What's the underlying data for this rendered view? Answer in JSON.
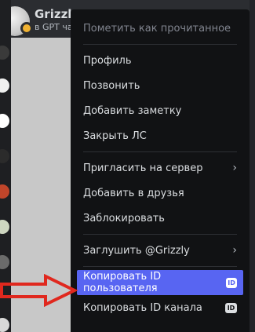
{
  "dm": {
    "name": "Grizzly",
    "subtitle": "в GPT ча"
  },
  "menu": {
    "mark_read": "Пометить как прочитанное",
    "profile": "Профиль",
    "call": "Позвонить",
    "add_note": "Добавить заметку",
    "close_dm": "Закрыть ЛС",
    "invite": "Пригласить на сервер",
    "add_friend": "Добавить в друзья",
    "block": "Заблокировать",
    "mute": "Заглушить @Grizzly",
    "copy_user_id": "Копировать ID пользователя",
    "copy_channel_id": "Копировать ID канала"
  },
  "badges": {
    "id": "ID"
  },
  "icons": {
    "submenu": "chevron-right-icon",
    "id_badge": "id-badge-icon",
    "pointer": "red-arrow-icon"
  },
  "colors": {
    "accent": "#5865f2",
    "menu_bg": "#111214",
    "arrow": "#e0281e",
    "status_idle": "#f0b232"
  }
}
